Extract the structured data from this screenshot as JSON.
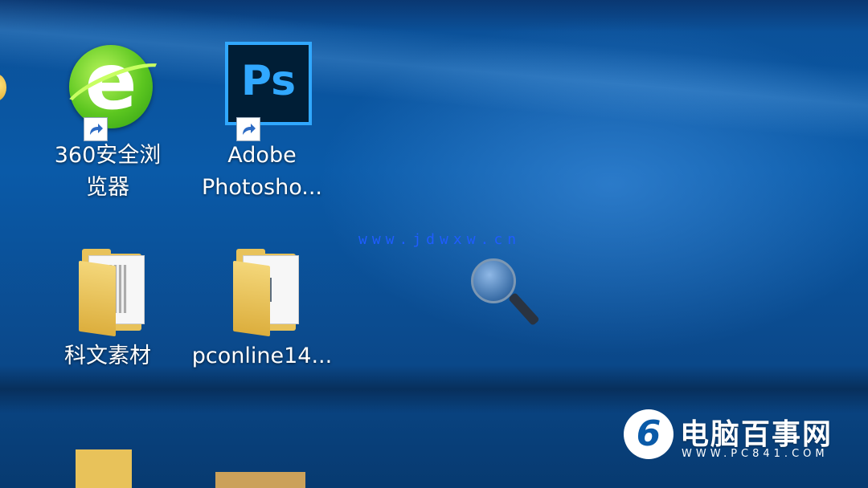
{
  "desktop": {
    "icons": [
      {
        "label": "360安全浏览器",
        "icon": "360-browser-icon"
      },
      {
        "label": "Adobe Photosho...",
        "icon": "photoshop-icon"
      },
      {
        "label": "科文素材",
        "icon": "folder-icon"
      },
      {
        "label": "pconline14...",
        "icon": "folder-icon"
      }
    ],
    "ps_text": "Ps",
    "browser_letter": "e"
  },
  "overlay": {
    "watermark_url": "www.jdwxw.cn",
    "brand_name": "电脑百事网",
    "brand_url": "WWW.PC841.COM",
    "brand_logo_text": "6"
  },
  "colors": {
    "accent": "#31a8ff",
    "browser_green": "#5cc620",
    "folder": "#e8c25a"
  }
}
